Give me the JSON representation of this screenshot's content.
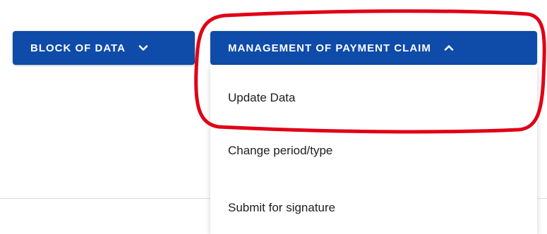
{
  "toolbar": {
    "block_label": "BLOCK OF DATA",
    "block_icon": "chevron-down-icon",
    "manage_label": "MANAGEMENT OF PAYMENT CLAIM",
    "manage_icon": "chevron-up-icon"
  },
  "dropdown": {
    "items": [
      {
        "label": "Update Data"
      },
      {
        "label": "Change period/type"
      },
      {
        "label": "Submit for signature"
      }
    ]
  },
  "colors": {
    "button_bg": "#0f4ba8",
    "highlight": "#e00016"
  }
}
